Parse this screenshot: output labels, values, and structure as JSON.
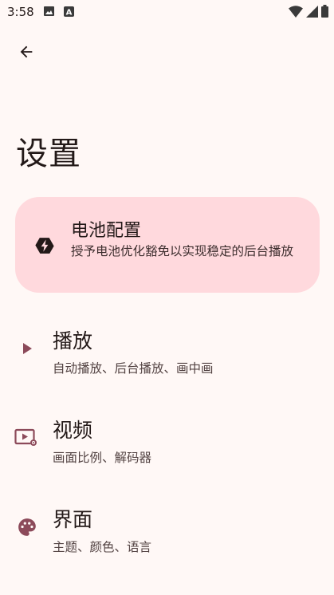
{
  "status_bar": {
    "time": "3:58",
    "icons": [
      "image-icon",
      "a-badge-icon",
      "wifi-icon",
      "signal-icon",
      "battery-icon"
    ]
  },
  "nav": {
    "back_icon": "arrow-left-icon"
  },
  "page": {
    "title": "设置"
  },
  "battery_card": {
    "icon": "battery-bolt-icon",
    "title": "电池配置",
    "description": "授予电池优化豁免以实现稳定的后台播放"
  },
  "settings": [
    {
      "icon": "play-icon",
      "title": "播放",
      "subtitle": "自动播放、后台播放、画中画"
    },
    {
      "icon": "video-settings-icon",
      "title": "视频",
      "subtitle": "画面比例、解码器"
    },
    {
      "icon": "palette-icon",
      "title": "界面",
      "subtitle": "主题、颜色、语言"
    }
  ],
  "colors": {
    "background": "#fff8f6",
    "card": "#ffd9dd",
    "accent": "#8c4a5a",
    "text": "#231918"
  }
}
